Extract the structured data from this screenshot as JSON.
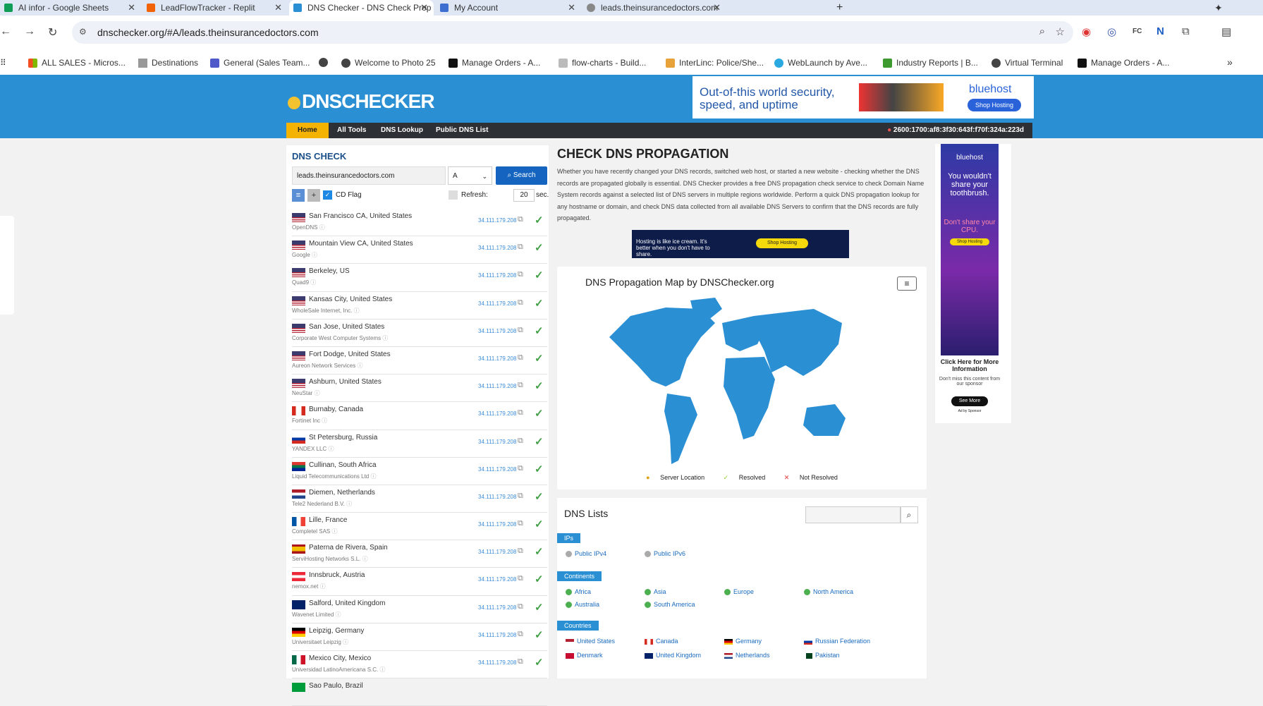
{
  "browser": {
    "tabs": [
      {
        "title": "AI infor - Google Sheets",
        "color": "#0f9d58"
      },
      {
        "title": "LeadFlowTracker - Replit",
        "color": "#f26207"
      },
      {
        "title": "DNS Checker - DNS Check Prop",
        "color": "#2b8fd4"
      },
      {
        "title": "My Account",
        "color": "#3d6fd1"
      },
      {
        "title": "leads.theinsurancedoctors.com",
        "color": "#666666"
      }
    ],
    "url": "dnschecker.org/#A/leads.theinsurancedoctors.com",
    "bookmarks": [
      "ALL SALES - Micros...",
      "Destinations",
      "General (Sales Team...",
      "Welcome to Photo 25",
      "Manage Orders - A...",
      "flow-charts - Build...",
      "InterLinc: Police/She...",
      "WebLaunch by Ave...",
      "Industry Reports | B...",
      "Virtual Terminal",
      "Manage Orders - A..."
    ]
  },
  "site": {
    "logo": "DNSCHECKER",
    "ad_top": {
      "text": "Out-of-this world security, speed, and uptime",
      "brand": "bluehost",
      "button": "Shop Hosting"
    },
    "menu": [
      "Home",
      "All Tools",
      "DNS Lookup",
      "Public DNS List"
    ],
    "ip": "2600:1700:af8:3f30:643f:f70f:324a:223d"
  },
  "check": {
    "heading": "DNS CHECK",
    "domain": "leads.theinsurancedoctors.com",
    "record": "A",
    "search": "Search",
    "cdflag": "CD Flag",
    "refresh_label": "Refresh:",
    "refresh_value": "20",
    "refresh_unit": "sec.",
    "results": [
      {
        "location": "San Francisco CA, United States",
        "provider": "OpenDNS",
        "ip": "34.111.179.208",
        "flag": "us"
      },
      {
        "location": "Mountain View CA, United States",
        "provider": "Google",
        "ip": "34.111.179.208",
        "flag": "us"
      },
      {
        "location": "Berkeley, US",
        "provider": "Quad9",
        "ip": "34.111.179.208",
        "flag": "us"
      },
      {
        "location": "Kansas City, United States",
        "provider": "WholeSale Internet, Inc.",
        "ip": "34.111.179.208",
        "flag": "us"
      },
      {
        "location": "San Jose, United States",
        "provider": "Corporate West Computer Systems",
        "ip": "34.111.179.208",
        "flag": "us"
      },
      {
        "location": "Fort Dodge, United States",
        "provider": "Aureon Network Services",
        "ip": "34.111.179.208",
        "flag": "us"
      },
      {
        "location": "Ashburn, United States",
        "provider": "NeuStar",
        "ip": "34.111.179.208",
        "flag": "us"
      },
      {
        "location": "Burnaby, Canada",
        "provider": "Fortinet Inc",
        "ip": "34.111.179.208",
        "flag": "ca"
      },
      {
        "location": "St Petersburg, Russia",
        "provider": "YANDEX LLC",
        "ip": "34.111.179.208",
        "flag": "ru"
      },
      {
        "location": "Cullinan, South Africa",
        "provider": "Liquid Telecommunications Ltd",
        "ip": "34.111.179.208",
        "flag": "za"
      },
      {
        "location": "Diemen, Netherlands",
        "provider": "Tele2 Nederland B.V.",
        "ip": "34.111.179.208",
        "flag": "nl"
      },
      {
        "location": "Lille, France",
        "provider": "Completel SAS",
        "ip": "34.111.179.208",
        "flag": "fr"
      },
      {
        "location": "Paterna de Rivera, Spain",
        "provider": "ServiHosting Networks S.L.",
        "ip": "34.111.179.208",
        "flag": "es"
      },
      {
        "location": "Innsbruck, Austria",
        "provider": "nemox.net",
        "ip": "34.111.179.208",
        "flag": "at"
      },
      {
        "location": "Salford, United Kingdom",
        "provider": "Wavenet Limited",
        "ip": "34.111.179.208",
        "flag": "gb"
      },
      {
        "location": "Leipzig, Germany",
        "provider": "Universitaet Leipzig",
        "ip": "34.111.179.208",
        "flag": "de"
      },
      {
        "location": "Mexico City, Mexico",
        "provider": "Universidad LatinoAmericana S.C.",
        "ip": "34.111.179.208",
        "flag": "mx"
      },
      {
        "location": "Sao Paulo, Brazil",
        "provider": "",
        "ip": "",
        "flag": "br"
      }
    ]
  },
  "propagation": {
    "title": "CHECK DNS PROPAGATION",
    "description": "Whether you have recently changed your DNS records, switched web host, or started a new website - checking whether the DNS records are propagated globally is essential. DNS Checker provides a free DNS propagation check service to check Domain Name System records against a selected list of DNS servers in multiple regions worldwide. Perform a quick DNS propagation lookup for any hostname or domain, and check DNS data collected from all available DNS Servers to confirm that the DNS records are fully propagated.",
    "ad_mid": "Hosting is like ice cream. It's better when you don't have to share.",
    "ad_mid_button": "Shop Hosting",
    "map_title": "DNS Propagation Map by DNSChecker.org",
    "legend": [
      "Server Location",
      "Resolved",
      "Not Resolved"
    ]
  },
  "lists": {
    "title": "DNS Lists",
    "ips_label": "IPs",
    "ips": [
      "Public IPv4",
      "Public IPv6"
    ],
    "continents_label": "Continents",
    "continents": [
      "Africa",
      "Asia",
      "Europe",
      "North America",
      "Australia",
      "South America"
    ],
    "countries_label": "Countries",
    "countries": [
      "United States",
      "Canada",
      "Germany",
      "Russian Federation",
      "Denmark",
      "United Kingdom",
      "Netherlands",
      "Pakistan"
    ]
  },
  "side_ad": {
    "brand": "bluehost",
    "line1": "You wouldn't share your toothbrush.",
    "line2": "Don't share your CPU.",
    "btn1": "Shop Hosting",
    "cta": "Click Here for More Information",
    "sub": "Don't miss this content from our sponsor",
    "btn2": "See More",
    "footer": "Ad by Sponsor"
  },
  "colors": {
    "accent": "#2b8fd4",
    "menu": "#2d3035",
    "home": "#f5b301",
    "ok": "#43a047"
  }
}
